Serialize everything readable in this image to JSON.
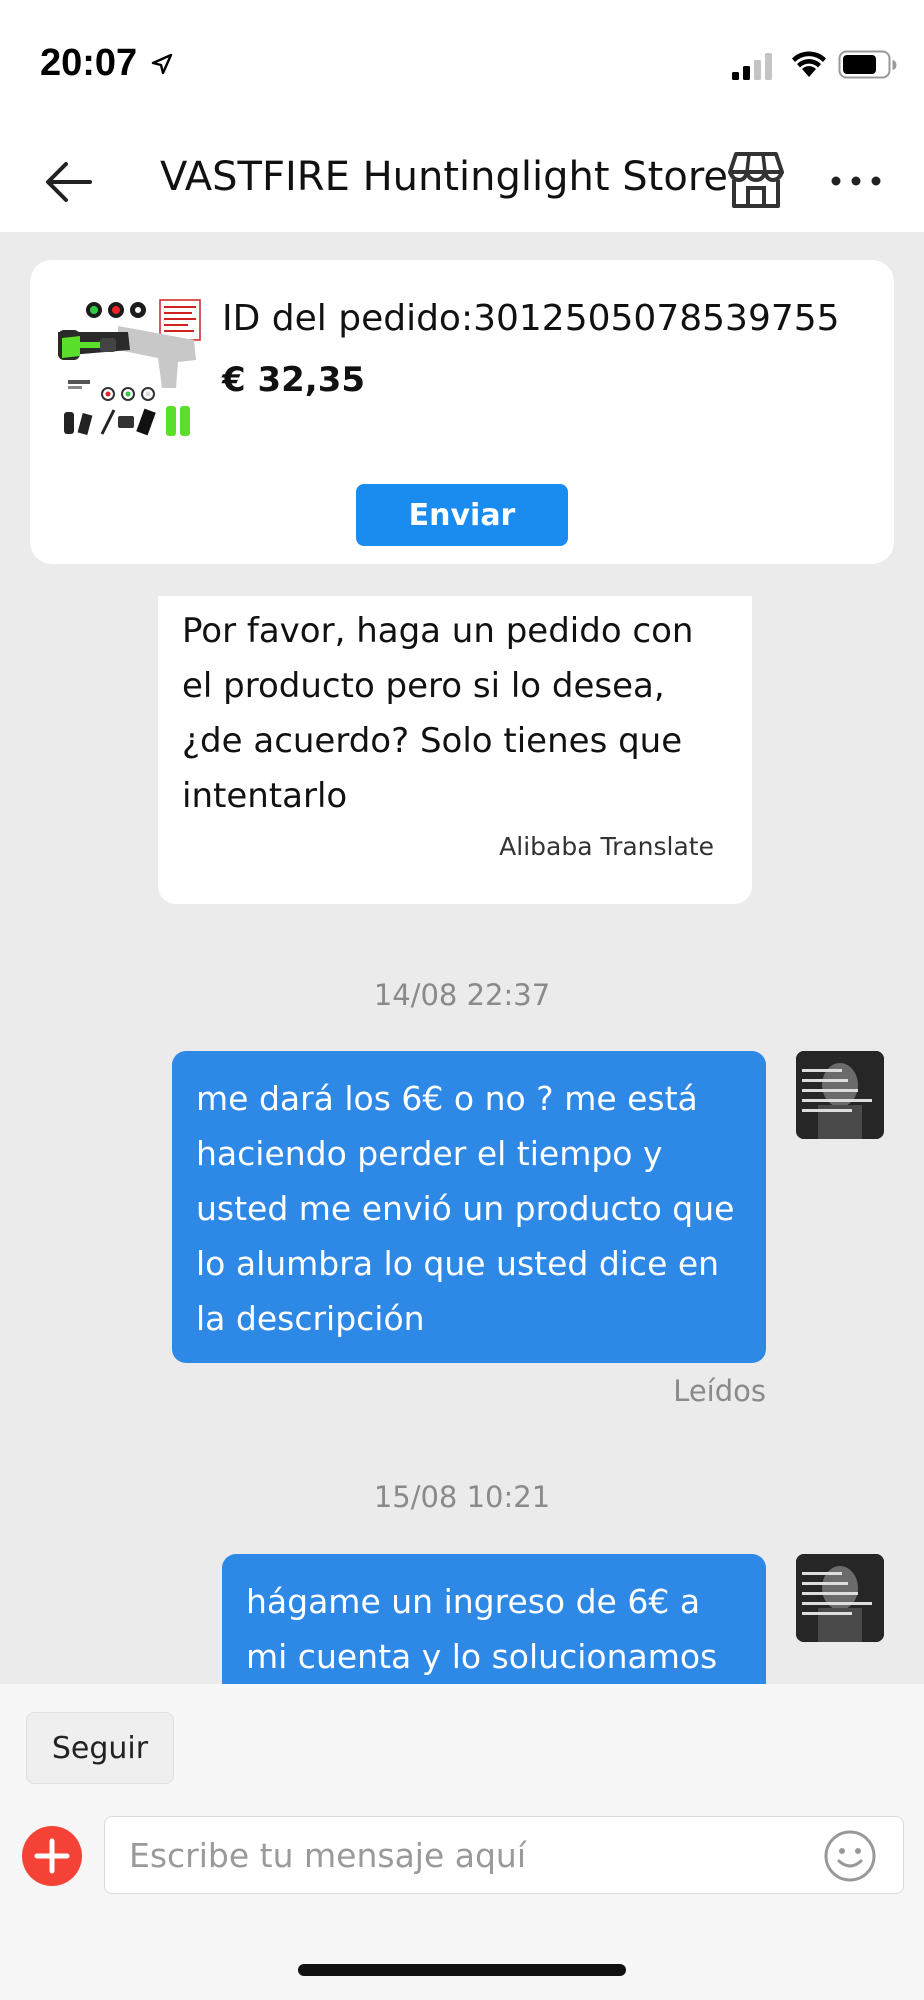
{
  "status_bar": {
    "time": "20:07"
  },
  "header": {
    "title": "VASTFIRE Huntinglight Store"
  },
  "order": {
    "id_text": "ID del pedido:3012505078539755",
    "price": "€ 32,35",
    "send_label": "Enviar"
  },
  "messages": {
    "incoming_text": "Por favor, haga un pedido con el producto pero si lo desea, ¿de acuerdo? Solo tienes que intentarlo",
    "incoming_translation": "Alibaba Translate",
    "timestamp_1": "14/08 22:37",
    "outgoing_1": "me dará los 6€ o no ? me está haciendo perder el tiempo y usted me envió un producto que lo alumbra lo que usted dice en la descripción",
    "read_status": "Leídos",
    "timestamp_2": "15/08 10:21",
    "outgoing_2": "hágame un ingreso de 6€ a mi cuenta y lo solucionamos"
  },
  "bottom": {
    "follow_label": "Seguir",
    "input_placeholder": "Escribe tu mensaje aquí"
  },
  "colors": {
    "accent": "#1a8cf0",
    "outgoing_bubble": "#2e88e6",
    "add_button": "#f44336",
    "background": "#ebebeb"
  },
  "icons": [
    "location-arrow-icon",
    "signal-icon",
    "wifi-icon",
    "battery-icon",
    "back-arrow-icon",
    "store-icon",
    "more-icon",
    "plus-icon",
    "emoji-icon"
  ]
}
